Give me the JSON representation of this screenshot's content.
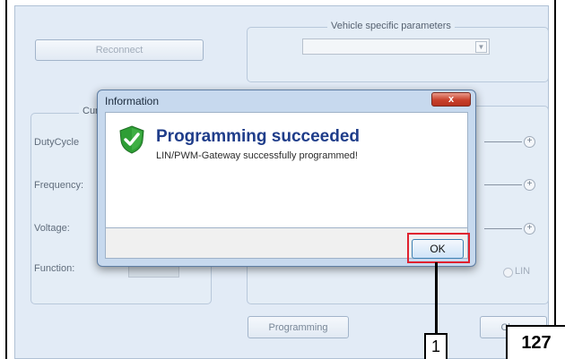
{
  "app": {
    "reconnect_label": "Reconnect",
    "vehicle_params_legend": "Vehicle specific parameters",
    "vehicle_select_value": "",
    "left_group_legend": "Cur",
    "labels": {
      "dutycycle": "DutyCycle",
      "frequency": "Frequency:",
      "voltage": "Voltage:",
      "function": "Function:"
    },
    "function_lin_label": "LIN",
    "programming_label": "Programming",
    "close_label": "Close"
  },
  "dialog": {
    "title": "Information",
    "close_glyph": "x",
    "heading": "Programming succeeded",
    "message": "LIN/PWM-Gateway successfully programmed!",
    "ok_label": "OK",
    "icon": "shield-check-icon"
  },
  "annotations": {
    "callout_number": "1",
    "page_number": "127"
  },
  "colors": {
    "heading": "#1f3d8a",
    "highlight": "#e0212f",
    "shield_green": "#2e9e35"
  }
}
